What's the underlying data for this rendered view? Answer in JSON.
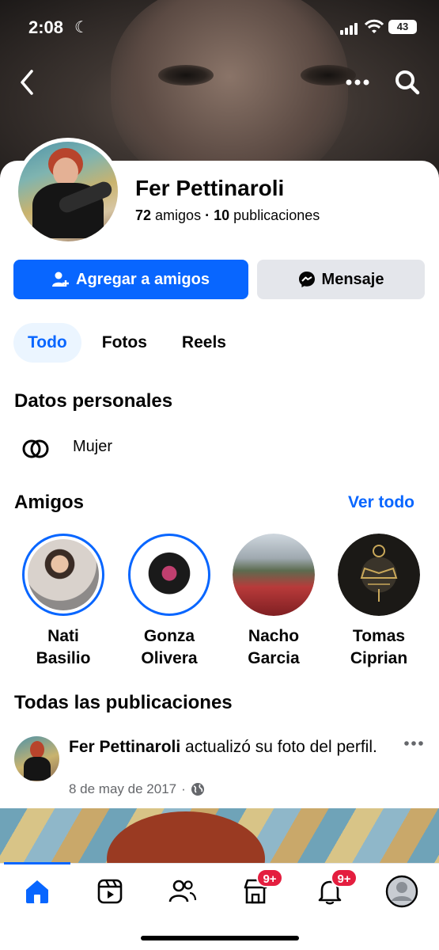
{
  "status_bar": {
    "time": "2:08",
    "battery": "43"
  },
  "profile": {
    "name": "Fer Pettinaroli",
    "friends_count": "72",
    "friends_word": "amigos",
    "separator": "·",
    "posts_count": "10",
    "posts_word": "publicaciones"
  },
  "actions": {
    "add_friend": "Agregar a amigos",
    "message": "Mensaje"
  },
  "tabs": [
    {
      "label": "Todo",
      "active": true
    },
    {
      "label": "Fotos",
      "active": false
    },
    {
      "label": "Reels",
      "active": false
    }
  ],
  "personal": {
    "heading": "Datos personales",
    "gender": "Mujer"
  },
  "friends_section": {
    "heading": "Amigos",
    "see_all": "Ver todo",
    "items": [
      {
        "first": "Nati",
        "last": "Basilio"
      },
      {
        "first": "Gonza",
        "last": "Olivera"
      },
      {
        "first": "Nacho",
        "last": "Garcia"
      },
      {
        "first": "Tomas",
        "last": "Ciprian"
      }
    ]
  },
  "posts_section": {
    "heading": "Todas las publicaciones"
  },
  "post": {
    "author": "Fer Pettinaroli",
    "action": " actualizó su foto del perfil.",
    "date": "8 de may de 2017",
    "dot": "·"
  },
  "tab_bar": {
    "friends_badge_feed": "9+",
    "notifications_badge": "9+"
  },
  "colors": {
    "accent": "#0866ff",
    "secondary_button": "#e4e6eb",
    "badge": "#e41e3f"
  }
}
